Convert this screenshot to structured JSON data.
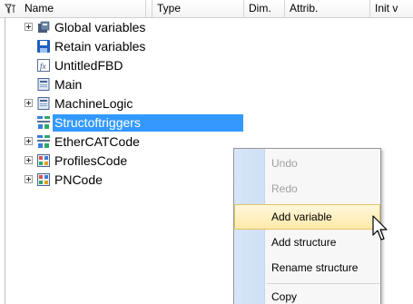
{
  "columns": {
    "name": "Name",
    "type": "Type",
    "dim": "Dim.",
    "attrib": "Attrib.",
    "init": "Init v"
  },
  "tree": [
    {
      "label": "Global variables",
      "icon": "global-variables-icon",
      "expandable": true
    },
    {
      "label": "Retain variables",
      "icon": "retain-variables-icon",
      "expandable": false
    },
    {
      "label": "UntitledFBD",
      "icon": "fbd-function-icon",
      "expandable": false
    },
    {
      "label": "Main",
      "icon": "program-icon",
      "expandable": false
    },
    {
      "label": "MachineLogic",
      "icon": "program-icon",
      "expandable": true
    },
    {
      "label": "Structoftriggers",
      "icon": "structure-icon",
      "expandable": false,
      "selected": true
    },
    {
      "label": "EtherCATCode",
      "icon": "structure-icon",
      "expandable": true
    },
    {
      "label": "ProfilesCode",
      "icon": "code-block-icon",
      "expandable": true
    },
    {
      "label": "PNCode",
      "icon": "code-block-icon",
      "expandable": true
    }
  ],
  "context_menu": {
    "items": [
      {
        "label": "Undo",
        "enabled": false
      },
      {
        "label": "Redo",
        "enabled": false
      },
      {
        "label": "Add variable",
        "enabled": true,
        "hovered": true
      },
      {
        "label": "Add structure",
        "enabled": true
      },
      {
        "label": "Rename structure",
        "enabled": true
      },
      {
        "label": "Copy",
        "enabled": true
      }
    ]
  },
  "colors": {
    "selection": "#3399ff",
    "menu_hover": "#ffe9a8",
    "menu_gutter": "#d7e6f8"
  }
}
